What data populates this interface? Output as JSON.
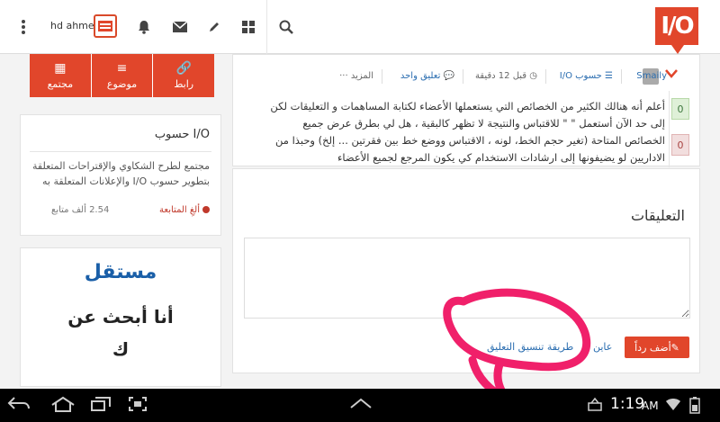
{
  "header": {
    "username": "hd ahmed",
    "logo_text": "I/O",
    "icons": [
      "search-icon",
      "grid-icon",
      "pencil-icon",
      "envelope-icon",
      "bell-icon",
      "menu-dots-icon"
    ]
  },
  "quick_actions": [
    {
      "label": "مجتمع",
      "icon": "grid-icon",
      "glyph": "▦"
    },
    {
      "label": "موضوع",
      "icon": "lines-icon",
      "glyph": "≡"
    },
    {
      "label": "رابط",
      "icon": "link-icon",
      "glyph": "🔗"
    }
  ],
  "community": {
    "title": "حسوب I/O",
    "description": "مجتمع لطرح الشكاوي والإقتراحات المتعلقة بتطوير حسوب I/O والإعلانات المتعلقة به",
    "unfollow_label": "ألغِ المتابعة",
    "followers": "2.54 ألف متابع"
  },
  "ad": {
    "brand": "مستقل",
    "line1": "أنا أبحث عن",
    "line2": "ك"
  },
  "post": {
    "author": "Smaily",
    "community": "حسوب I/O",
    "time": "قبل 12 دقيقة",
    "comments": "تعليق واحد",
    "more": "المزيد",
    "upvotes": "0",
    "downvotes": "0",
    "body": "أعلم أنه هنالك الكثير من الخصائص التي يستعملها الأعضاء لكتابة المساهمات و التعليقات لكن إلى حد الآن أستعمل \" \" للاقتباس والنتيجة لا تظهر كالبقية ، هل لي بطرق عرض جميع الخصائص المتاحة (تغير حجم الخط، لونه ، الاقتباس ووضع خط بين فقرتين ... إلخ) وحبذا من الاداريين لو يضيفونها إلى ارشادات الاستخدام كي يكون المرجع لجميع الأعضاء"
  },
  "comments": {
    "heading": "التعليقات",
    "placeholder": "",
    "add_button": "أضف رداً",
    "preview_link": "عاين",
    "format_link": "طريقة تنسيق التعليق"
  },
  "system_bar": {
    "time": "1:19",
    "ampm": "AM"
  },
  "colors": {
    "accent": "#e1462b",
    "link": "#2a6db0",
    "annotation": "#f0206a"
  }
}
